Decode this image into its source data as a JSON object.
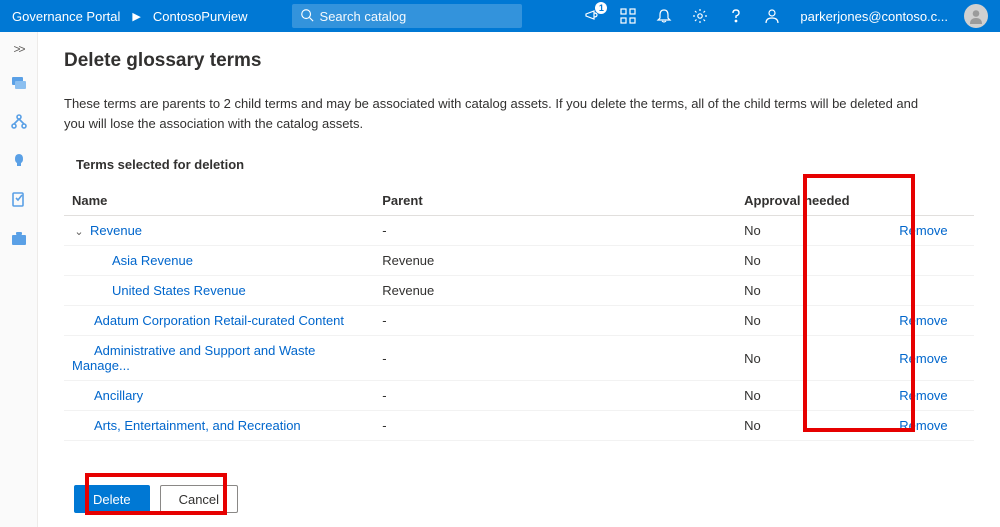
{
  "header": {
    "portal": "Governance Portal",
    "context": "ContosoPurview",
    "search_placeholder": "Search catalog",
    "notifications_badge": "1",
    "user_email": "parkerjones@contoso.c..."
  },
  "page": {
    "title": "Delete glossary terms",
    "warning": "These terms are parents to 2 child terms and may be associated with catalog assets. If you delete the terms, all of the child terms will be deleted and you will lose the association with the catalog assets.",
    "section_label": "Terms selected for deletion"
  },
  "table": {
    "headers": {
      "name": "Name",
      "parent": "Parent",
      "approval": "Approval needed"
    },
    "remove_label": "Remove",
    "rows": [
      {
        "name": "Revenue",
        "parent": "-",
        "approval": "No",
        "removable": true,
        "expandable": true,
        "indent": 0
      },
      {
        "name": "Asia Revenue",
        "parent": "Revenue",
        "approval": "No",
        "removable": false,
        "expandable": false,
        "indent": 1
      },
      {
        "name": "United States Revenue",
        "parent": "Revenue",
        "approval": "No",
        "removable": false,
        "expandable": false,
        "indent": 1
      },
      {
        "name": "Adatum Corporation Retail-curated Content",
        "parent": "-",
        "approval": "No",
        "removable": true,
        "expandable": false,
        "indent": 0
      },
      {
        "name": "Administrative and Support and Waste Manage...",
        "parent": "-",
        "approval": "No",
        "removable": true,
        "expandable": false,
        "indent": 0
      },
      {
        "name": "Ancillary",
        "parent": "-",
        "approval": "No",
        "removable": true,
        "expandable": false,
        "indent": 0
      },
      {
        "name": "Arts, Entertainment, and Recreation",
        "parent": "-",
        "approval": "No",
        "removable": true,
        "expandable": false,
        "indent": 0
      }
    ]
  },
  "buttons": {
    "delete": "Delete",
    "cancel": "Cancel"
  }
}
